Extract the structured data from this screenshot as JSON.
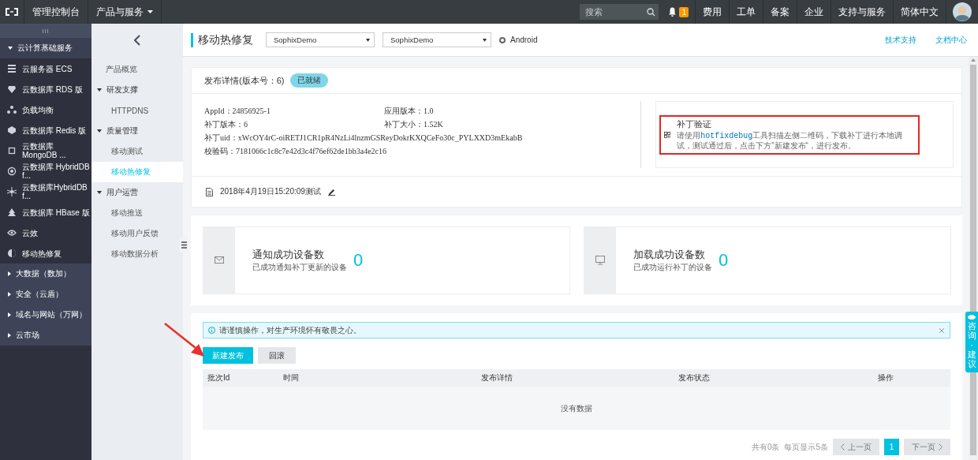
{
  "topbar": {
    "menu": [
      {
        "label": "管理控制台",
        "dropdown": false
      },
      {
        "label": "产品与服务",
        "dropdown": true
      }
    ],
    "search": {
      "placeholder": "搜索"
    },
    "notifications": "1",
    "links": [
      "费用",
      "工单",
      "备案",
      "企业",
      "支持与服务",
      "简体中文"
    ]
  },
  "sidebar": {
    "toggle": "III",
    "groups": [
      {
        "label": "云计算基础服务",
        "expanded": true,
        "items": [
          {
            "label": "云服务器 ECS"
          },
          {
            "label": "云数据库 RDS 版"
          },
          {
            "label": "负载均衡"
          },
          {
            "label": "云数据库 Redis 版"
          },
          {
            "label": "云数据库 MongoDB ..."
          },
          {
            "label": "云数据库 HybridDB f..."
          },
          {
            "label": "云数据库HybridDB f..."
          },
          {
            "label": "云数据库 HBase 版"
          },
          {
            "label": "云效"
          },
          {
            "label": "移动热修复"
          }
        ]
      },
      {
        "label": "大数据（数加）",
        "expanded": false
      },
      {
        "label": "安全（云盾）",
        "expanded": false
      },
      {
        "label": "域名与网站（万网）",
        "expanded": false
      },
      {
        "label": "云市场",
        "expanded": false
      }
    ]
  },
  "subnav": {
    "items": [
      {
        "label": "产品概览",
        "selected": false
      },
      {
        "label": "研发支撑",
        "expanded": true,
        "children": [
          {
            "label": "HTTPDNS",
            "selected": false
          }
        ]
      },
      {
        "label": "质量管理",
        "expanded": true,
        "children": [
          {
            "label": "移动测试",
            "selected": false
          },
          {
            "label": "移动热修复",
            "selected": true
          }
        ]
      },
      {
        "label": "用户运营",
        "expanded": true,
        "children": [
          {
            "label": "移动推送",
            "selected": false
          },
          {
            "label": "移动用户反馈",
            "selected": false
          },
          {
            "label": "移动数据分析",
            "selected": false
          }
        ]
      }
    ]
  },
  "header": {
    "title": "移动热修复",
    "selects": [
      "SophixDemo",
      "SophixDemo"
    ],
    "platform": {
      "label": "Android",
      "selected": true
    },
    "links": [
      "技术支持",
      "文档中心"
    ]
  },
  "release": {
    "title": "发布详情(版本号：6)",
    "status": "已就绪",
    "info": [
      [
        "AppId：24856925-1",
        "应用版本：1.0"
      ],
      [
        "补丁版本：6",
        "补丁大小：1.52K"
      ],
      [
        "补丁uid：xWcOY4rC-oiRETJ1CR1pR4NzLi4lnzmGSReyDokrKXQCeFo30c_PYLXXD3mEkabB"
      ],
      [
        "校验码：7181066c1c8c7e42d3c4f76ef62de1bb3a4e2c16"
      ]
    ],
    "verify": {
      "title": "补丁验证",
      "text": "请使用**hotfixdebug**工具扫描左侧二维码，下载补丁进行本地调试，测试通过后，点击下方”新建发布“，进行发布。",
      "highlighted": true
    },
    "note": "2018年4月19日15:20:09测试"
  },
  "stats": [
    {
      "title": "通知成功设备数",
      "subtitle": "已成功通知补丁更新的设备",
      "value": "0"
    },
    {
      "title": "加载成功设备数",
      "subtitle": "已成功运行补丁的设备",
      "value": "0"
    }
  ],
  "releases": {
    "alert": "请谨慎操作，对生产环境怀有敬畏之心。",
    "buttons": [
      {
        "label": "新建发布",
        "kind": "primary"
      },
      {
        "label": "回滚",
        "kind": "default"
      }
    ],
    "table": {
      "columns": [
        "批次Id",
        "时间",
        "发布详情",
        "发布状态",
        "操作"
      ],
      "empty": "没有数据"
    },
    "pagination": {
      "total": "共有0条",
      "per_page": "每页显示5条",
      "prev": {
        "label": "上一页",
        "disabled": true
      },
      "pages": [
        {
          "label": "1",
          "selected": true
        }
      ],
      "next": {
        "label": "下一页",
        "disabled": true
      }
    }
  },
  "float_tab": "咨询·建议"
}
